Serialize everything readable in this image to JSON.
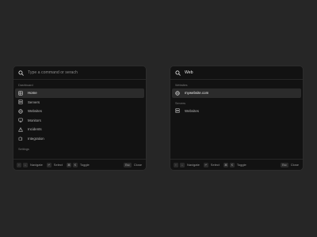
{
  "left": {
    "search": {
      "placeholder": "Type a command or serach",
      "value": ""
    },
    "section_dashboard": "Dashboard",
    "items": [
      {
        "label": "Home",
        "icon": "grid-icon",
        "active": true
      },
      {
        "label": "Servers",
        "icon": "server-icon",
        "active": false
      },
      {
        "label": "Websites",
        "icon": "globe-icon",
        "active": false
      },
      {
        "label": "Monitors",
        "icon": "monitor-icon",
        "active": false
      },
      {
        "label": "Incidents",
        "icon": "warning-icon",
        "active": false
      },
      {
        "label": "Integration",
        "icon": "puzzle-icon",
        "active": false
      }
    ],
    "section_settings": "Settings"
  },
  "right": {
    "search": {
      "placeholder": "",
      "value": "Web"
    },
    "section_websites": "Websites",
    "website_result": "mywebsite.com",
    "section_servers": "Servers",
    "server_result": "Websites"
  },
  "footer": {
    "up_key": "↑",
    "down_key": "↓",
    "navigate": "Navigate",
    "enter_key": "↵",
    "select": "Select",
    "toggle_key_1": "⌘",
    "toggle_key_2": "K",
    "toggle": "Toggle",
    "esc_key": "Esc",
    "close": "Close"
  },
  "colors": {
    "background": "#262626",
    "panel": "#121212",
    "active_row": "#2b2b2b"
  }
}
